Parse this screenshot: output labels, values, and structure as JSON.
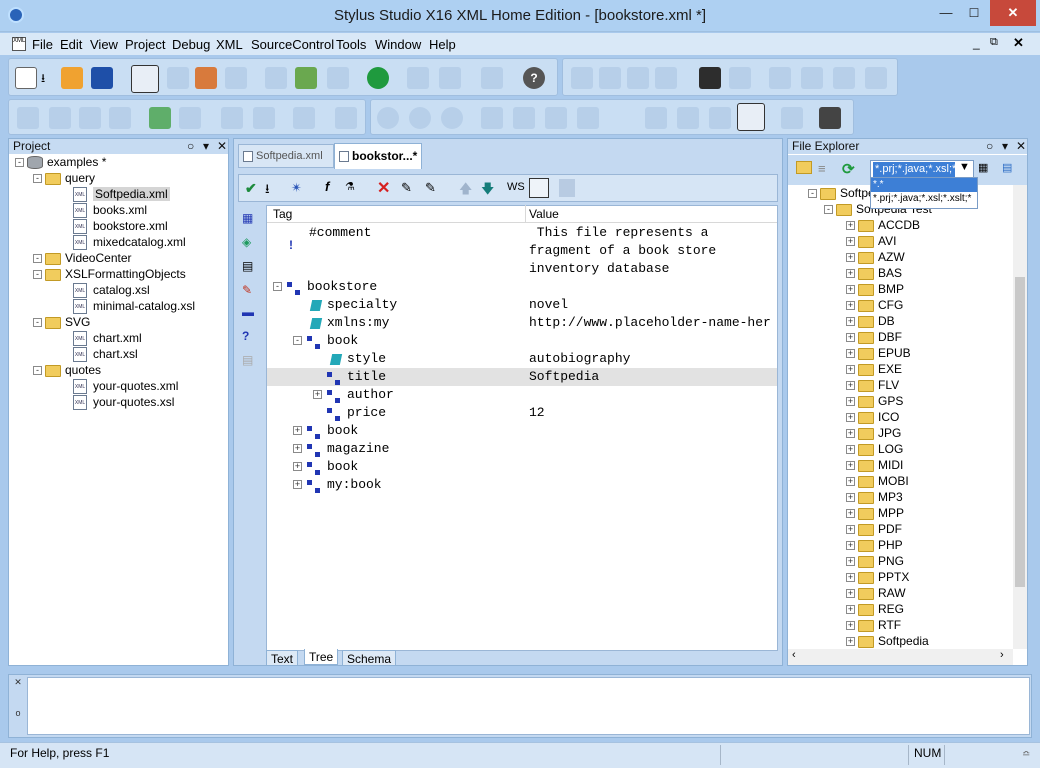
{
  "window": {
    "title": "Stylus Studio X16 XML Home Edition - [bookstore.xml *]"
  },
  "menu": [
    "File",
    "Edit",
    "View",
    "Project",
    "Debug",
    "XML",
    "SourceControl",
    "Tools",
    "Window",
    "Help"
  ],
  "project": {
    "title": "Project",
    "root": "examples *",
    "items": [
      {
        "label": "query",
        "type": "folder",
        "depth": 1
      },
      {
        "label": "Softpedia.xml",
        "type": "file",
        "depth": 2,
        "selected": true
      },
      {
        "label": "books.xml",
        "type": "file",
        "depth": 2
      },
      {
        "label": "bookstore.xml",
        "type": "file",
        "depth": 2
      },
      {
        "label": "mixedcatalog.xml",
        "type": "file",
        "depth": 2
      },
      {
        "label": "VideoCenter",
        "type": "folder",
        "depth": 1
      },
      {
        "label": "XSLFormattingObjects",
        "type": "folder",
        "depth": 1
      },
      {
        "label": "catalog.xsl",
        "type": "file",
        "depth": 2
      },
      {
        "label": "minimal-catalog.xsl",
        "type": "file",
        "depth": 2
      },
      {
        "label": "SVG",
        "type": "folder",
        "depth": 1
      },
      {
        "label": "chart.xml",
        "type": "file",
        "depth": 2
      },
      {
        "label": "chart.xsl",
        "type": "file",
        "depth": 2
      },
      {
        "label": "quotes",
        "type": "folder",
        "depth": 1
      },
      {
        "label": "your-quotes.xml",
        "type": "file",
        "depth": 2
      },
      {
        "label": "your-quotes.xsl",
        "type": "file",
        "depth": 2
      }
    ]
  },
  "editor": {
    "tabs": [
      "Softpedia.xml",
      "bookstor...*"
    ],
    "toolbar_ws": "WS",
    "columns": {
      "tag": "Tag",
      "value": "Value"
    },
    "rows": [
      {
        "tag": "#comment",
        "value": " This file represents a",
        "indent": 1,
        "icon": "none"
      },
      {
        "tag": "",
        "value": "fragment of a book store",
        "indent": 1,
        "icon": "none"
      },
      {
        "tag": "",
        "value": "inventory database",
        "indent": 1,
        "icon": "none"
      },
      {
        "tag": "bookstore",
        "value": "",
        "indent": 0,
        "icon": "elem",
        "exp": "-"
      },
      {
        "tag": "specialty",
        "value": "novel",
        "indent": 1,
        "icon": "attr"
      },
      {
        "tag": "xmlns:my",
        "value": "http://www.placeholder-name-her",
        "indent": 1,
        "icon": "attr"
      },
      {
        "tag": "book",
        "value": "",
        "indent": 1,
        "icon": "elem",
        "exp": "-"
      },
      {
        "tag": "style",
        "value": "autobiography",
        "indent": 2,
        "icon": "attr"
      },
      {
        "tag": "title",
        "value": "Softpedia",
        "indent": 2,
        "icon": "elem",
        "selected": true
      },
      {
        "tag": "author",
        "value": "",
        "indent": 2,
        "icon": "elem",
        "exp": "+"
      },
      {
        "tag": "price",
        "value": "12",
        "indent": 2,
        "icon": "elem"
      },
      {
        "tag": "book",
        "value": "",
        "indent": 1,
        "icon": "elem",
        "exp": "+"
      },
      {
        "tag": "magazine",
        "value": "",
        "indent": 1,
        "icon": "elem",
        "exp": "+"
      },
      {
        "tag": "book",
        "value": "",
        "indent": 1,
        "icon": "elem",
        "exp": "+"
      },
      {
        "tag": "my:book",
        "value": "",
        "indent": 1,
        "icon": "elem",
        "exp": "+"
      }
    ],
    "bottom_tabs": [
      "Text",
      "Tree",
      "Schema"
    ]
  },
  "file_explorer": {
    "title": "File Explorer",
    "filter": "*.prj;*.java;*.xsl;*",
    "dropdown_options": [
      "*.*",
      "*.prj;*.java;*.xsl;*.xslt;*"
    ],
    "root_partial": "Softpe",
    "sub_partial": "Softpedia Test",
    "folders": [
      "ACCDB",
      "AVI",
      "AZW",
      "BAS",
      "BMP",
      "CFG",
      "DB",
      "DBF",
      "EPUB",
      "EXE",
      "FLV",
      "GPS",
      "ICO",
      "JPG",
      "LOG",
      "MIDI",
      "MOBI",
      "MP3",
      "MPP",
      "PDF",
      "PHP",
      "PNG",
      "PPTX",
      "RAW",
      "REG",
      "RTF",
      "Softpedia"
    ]
  },
  "statusbar": {
    "help": "For Help, press F1",
    "num": "NUM"
  },
  "output_side": "o"
}
